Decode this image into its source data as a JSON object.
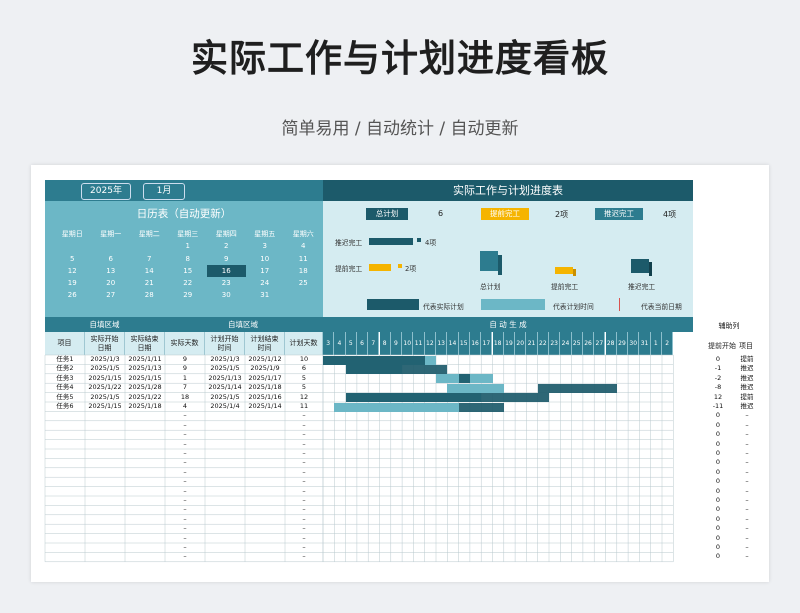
{
  "title": "实际工作与计划进度看板",
  "subtitle": "简单易用  /  自动统计  /  自动更新",
  "calendar": {
    "year_label": "2025年",
    "month_label": "1月",
    "title": "日历表（自动更新）",
    "weekdays": [
      "星期日",
      "星期一",
      "星期二",
      "星期三",
      "星期四",
      "星期五",
      "星期六"
    ],
    "weeks": [
      [
        "",
        "",
        "",
        "1",
        "2",
        "3",
        "4"
      ],
      [
        "5",
        "6",
        "7",
        "8",
        "9",
        "10",
        "11"
      ],
      [
        "12",
        "13",
        "14",
        "15",
        "16",
        "17",
        "18"
      ],
      [
        "19",
        "20",
        "21",
        "22",
        "23",
        "24",
        "25"
      ],
      [
        "26",
        "27",
        "28",
        "29",
        "30",
        "31",
        ""
      ]
    ],
    "today": "16"
  },
  "progress": {
    "title": "实际工作与计划进度表",
    "total_label": "总计划",
    "total_value": "6",
    "early_label": "提前完工",
    "early_value": "2项",
    "late_label": "推迟完工",
    "late_value": "4项",
    "bar_late_label": "推迟完工",
    "bar_late_value": "4项",
    "bar_early_label": "提前完工",
    "bar_early_value": "2项",
    "cube_total_label": "总计划",
    "cube_early_label": "提前完工",
    "cube_late_label": "推迟完工",
    "legend_actual": "代表实际计划",
    "legend_plan": "代表计划时间",
    "legend_today": "代表当前日期"
  },
  "table": {
    "band_fill_1": "自填区域",
    "band_fill_2": "自填区域",
    "band_auto": "自     动     生     成",
    "headers": [
      "项目",
      "实际开始日期",
      "实际结束日期",
      "实际天数",
      "计划开始时间",
      "计划结束时间",
      "计划天数"
    ],
    "header_lines": [
      [
        "项目"
      ],
      [
        "实际开始",
        "日期"
      ],
      [
        "实际结束",
        "日期"
      ],
      [
        "实际天数"
      ],
      [
        "计划开始",
        "时间"
      ],
      [
        "计划结束",
        "时间"
      ],
      [
        "计划天数"
      ]
    ],
    "days": [
      "3",
      "4",
      "5",
      "6",
      "7",
      "8",
      "9",
      "10",
      "11",
      "12",
      "13",
      "14",
      "15",
      "16",
      "17",
      "18",
      "19",
      "20",
      "21",
      "22",
      "23",
      "24",
      "25",
      "26",
      "27",
      "28",
      "29",
      "30",
      "31",
      "1",
      "2"
    ],
    "rows": [
      [
        "任务1",
        "2025/1/3",
        "2025/1/11",
        "9",
        "2025/1/3",
        "2025/1/12",
        "10"
      ],
      [
        "任务2",
        "2025/1/5",
        "2025/1/13",
        "9",
        "2025/1/5",
        "2025/1/9",
        "6"
      ],
      [
        "任务3",
        "2025/1/15",
        "2025/1/15",
        "1",
        "2025/1/13",
        "2025/1/17",
        "5"
      ],
      [
        "任务4",
        "2025/1/22",
        "2025/1/28",
        "7",
        "2025/1/14",
        "2025/1/18",
        "5"
      ],
      [
        "任务5",
        "2025/1/5",
        "2025/1/22",
        "18",
        "2025/1/5",
        "2025/1/16",
        "12"
      ],
      [
        "任务6",
        "2025/1/15",
        "2025/1/18",
        "4",
        "2025/1/4",
        "2025/1/14",
        "11"
      ]
    ],
    "empty_placeholder": "–",
    "empty_row_count": 16
  },
  "gantt": {
    "plan_bars": [
      [
        3,
        12
      ],
      [
        5,
        9
      ],
      [
        13,
        17
      ],
      [
        14,
        18
      ],
      [
        5,
        16
      ],
      [
        4,
        14
      ]
    ],
    "actual_bars": [
      [
        3,
        11
      ],
      [
        5,
        13
      ],
      [
        15,
        15
      ],
      [
        22,
        28
      ],
      [
        5,
        22
      ],
      [
        15,
        18
      ]
    ]
  },
  "aux": {
    "title": "辅助列",
    "col1": "提前",
    "col2": "开始",
    "col3": "项目",
    "rows": [
      [
        "0",
        "提前"
      ],
      [
        "-1",
        "推迟"
      ],
      [
        "-2",
        "推迟"
      ],
      [
        "-8",
        "推迟"
      ],
      [
        "12",
        "提前"
      ],
      [
        "-11",
        "推迟"
      ]
    ],
    "empty_values": [
      "0",
      "–"
    ]
  },
  "colors": {
    "dark_teal": "#1c5a6a",
    "teal": "#2d7c8f",
    "light_teal": "#6cb7c6",
    "pale": "#d5ecf1",
    "orange": "#f5b400",
    "today_line": "#d9534f"
  }
}
